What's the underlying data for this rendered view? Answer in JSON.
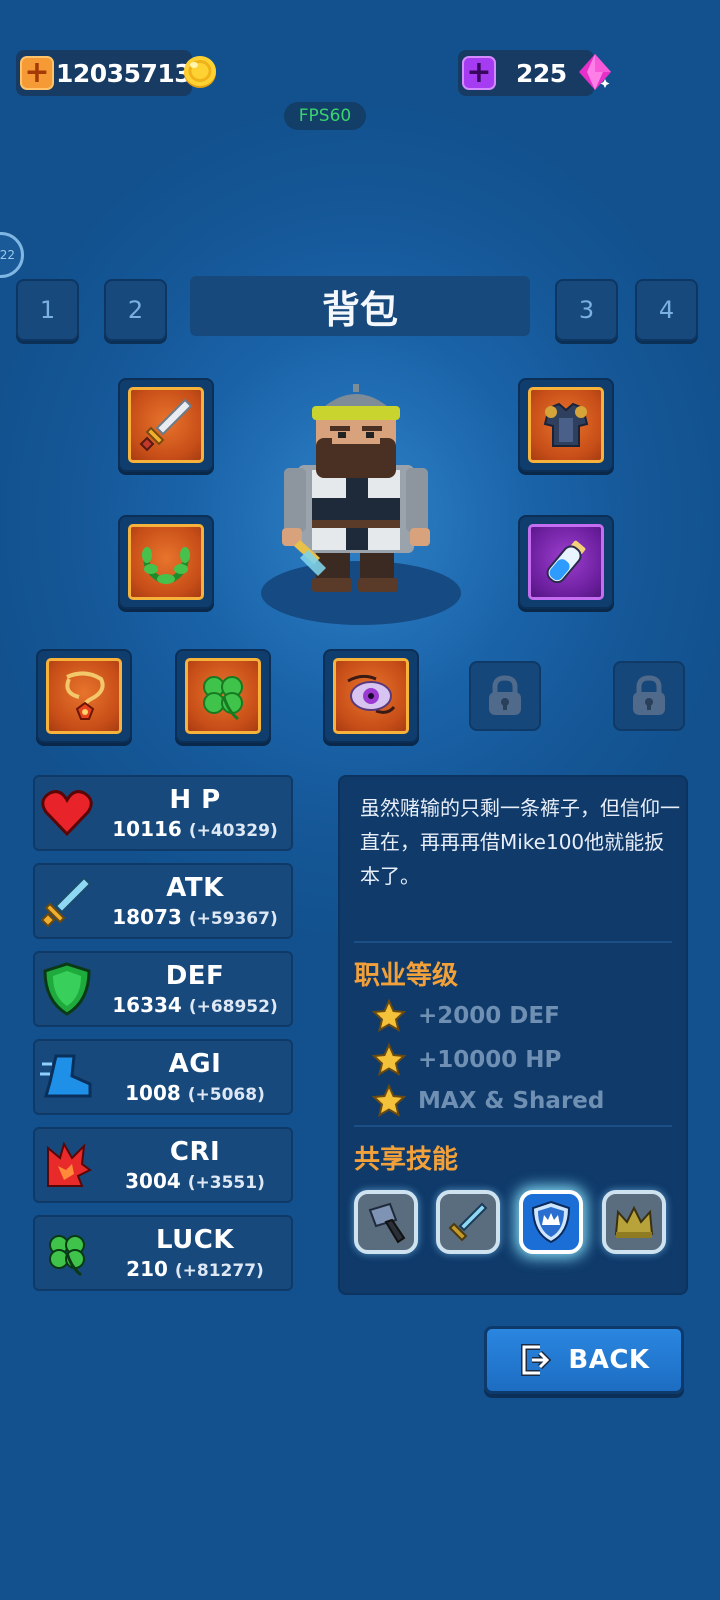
{
  "currency": {
    "gold": "12035713",
    "gems": "225",
    "plus_symbol": "+",
    "gold_icon": "gold-coin-icon",
    "gem_icon": "pink-gem-icon"
  },
  "fps_label": "FPS60",
  "side_badge": "22",
  "tabs": [
    "1",
    "2",
    "3",
    "4"
  ],
  "title": "背包",
  "equipment": [
    {
      "icon": "sword-icon",
      "frame": "orange"
    },
    {
      "icon": "armor-icon",
      "frame": "orange"
    },
    {
      "icon": "laurel-icon",
      "frame": "orange"
    },
    {
      "icon": "potion-icon",
      "frame": "purple"
    },
    {
      "icon": "amulet-icon",
      "frame": "orange"
    },
    {
      "icon": "clover-icon",
      "frame": "orange"
    },
    {
      "icon": "eye-pendant-icon",
      "frame": "orange"
    },
    {
      "icon": "lock-icon",
      "frame": "locked"
    },
    {
      "icon": "lock-icon",
      "frame": "locked"
    }
  ],
  "stats": [
    {
      "name": "H P",
      "value": "10116",
      "bonus": "(+40329)",
      "icon": "heart-icon"
    },
    {
      "name": "ATK",
      "value": "18073",
      "bonus": "(+59367)",
      "icon": "sword-icon"
    },
    {
      "name": "DEF",
      "value": "16334",
      "bonus": "(+68952)",
      "icon": "shield-icon"
    },
    {
      "name": "AGI",
      "value": "1008",
      "bonus": "(+5068)",
      "icon": "boot-icon"
    },
    {
      "name": "CRI",
      "value": "3004",
      "bonus": "(+3551)",
      "icon": "crit-burst-icon"
    },
    {
      "name": "LUCK",
      "value": "210",
      "bonus": "(+81277)",
      "icon": "clover-icon"
    }
  ],
  "description": "虽然赌输的只剩一条裤子，但信仰一直在，再再再借Mike100他就能扳本了。",
  "class_level": {
    "heading": "职业等级",
    "bonuses": [
      "+2000 DEF",
      "+10000 HP",
      "MAX & Shared"
    ]
  },
  "shared_skills": {
    "heading": "共享技能",
    "skills": [
      {
        "icon": "hammer-icon",
        "active": false
      },
      {
        "icon": "sword-icon",
        "active": false
      },
      {
        "icon": "crown-shield-icon",
        "active": true
      },
      {
        "icon": "crown-icon",
        "active": false
      }
    ]
  },
  "back_button": "BACK",
  "colors": {
    "accent_orange": "#f2a13a",
    "fps_green": "#3ad36e",
    "gem_purple": "#a53cf2"
  }
}
